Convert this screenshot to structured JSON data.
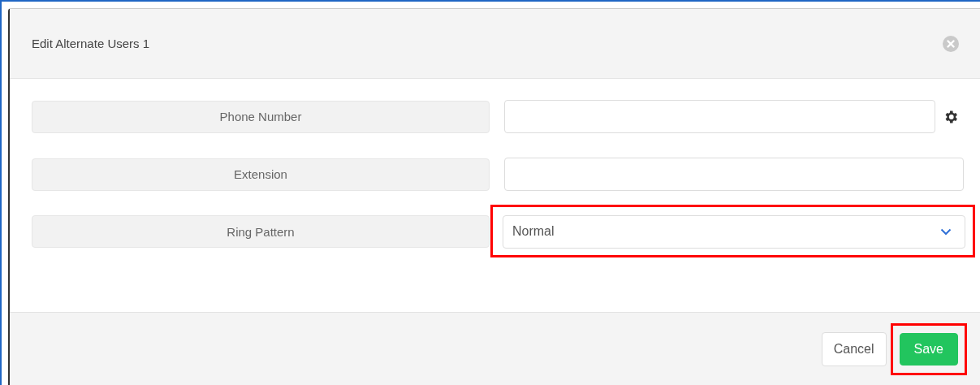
{
  "dialog": {
    "title": "Edit Alternate Users 1"
  },
  "fields": [
    {
      "label": "Phone Number",
      "kind": "text",
      "settings": true,
      "highlighted": false
    },
    {
      "label": "Extension",
      "kind": "text",
      "settings": false,
      "highlighted": false
    },
    {
      "label": "Ring Pattern",
      "kind": "select",
      "value": "Normal",
      "highlighted": true
    }
  ],
  "buttons": [
    {
      "label": "Cancel",
      "kind": "default",
      "highlighted": false
    },
    {
      "label": "Save",
      "kind": "primary",
      "highlighted": true
    }
  ]
}
